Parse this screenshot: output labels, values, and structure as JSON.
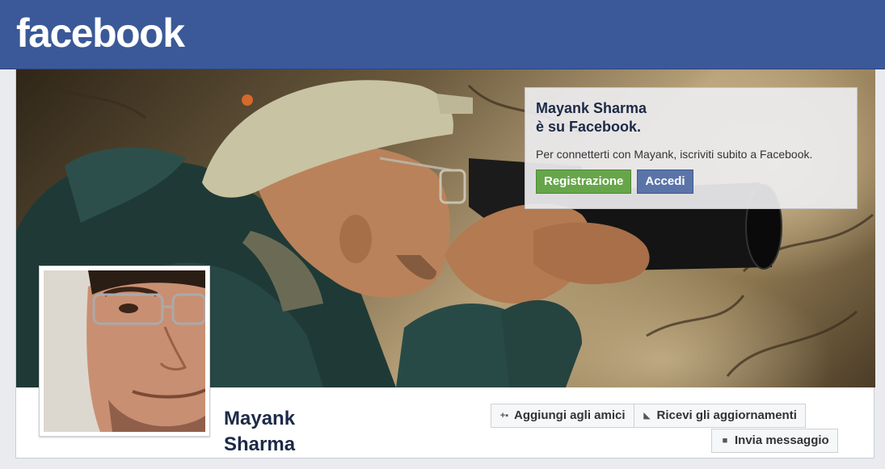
{
  "brand": {
    "logo_text": "facebook",
    "color": "#3b5998"
  },
  "signup": {
    "title_line1": "Mayank Sharma",
    "title_line2": "è su Facebook.",
    "prompt": "Per connetterti con Mayank, iscriviti subito a Facebook.",
    "register_label": "Registrazione",
    "login_label": "Accedi"
  },
  "profile": {
    "first_name": "Mayank",
    "last_name": "Sharma"
  },
  "actions": {
    "add_friend_label": "Aggiungi agli amici",
    "add_friend_icon": "add-friend-icon",
    "follow_label": "Ricevi gli aggiornamenti",
    "follow_icon": "rss-icon",
    "message_label": "Invia messaggio",
    "message_icon": "speech-bubble-icon"
  },
  "colors": {
    "accent": "#3b5998",
    "register_green": "#67a54b",
    "login_blue": "#5b74a8"
  }
}
